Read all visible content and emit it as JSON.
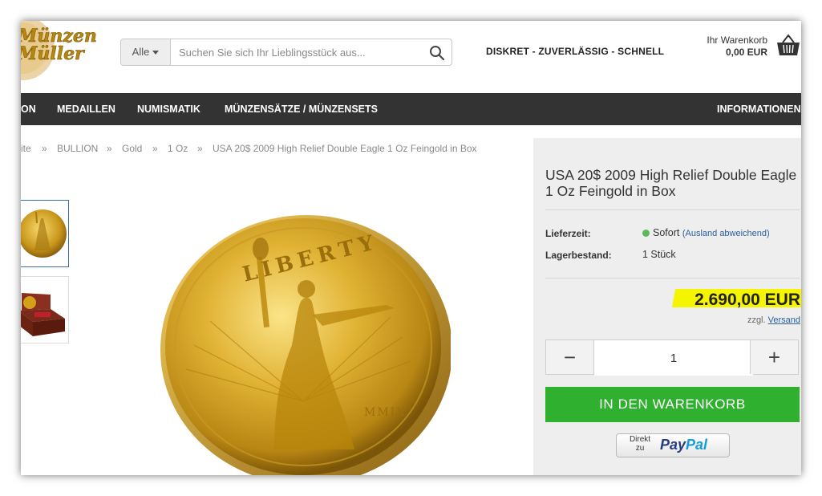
{
  "header": {
    "logo_line1": "Münzen",
    "logo_line2": "Müller",
    "search": {
      "category": "Alle",
      "placeholder": "Suchen Sie sich Ihr Lieblingsstück aus..."
    },
    "tagline": "DISKRET - ZUVERLÄSSIG - SCHNELL",
    "cart": {
      "label": "Ihr Warenkorb",
      "amount": "0,00 EUR"
    }
  },
  "nav": {
    "items": [
      "ON",
      "MEDAILLEN",
      "NUMISMATIK",
      "MÜNZENSÄTZE / MÜNZENSETS",
      "INFORMATIONEN"
    ]
  },
  "breadcrumb": {
    "items": [
      "ite",
      "BULLION",
      "Gold",
      "1 Oz",
      "USA 20$ 2009 High Relief Double Eagle 1 Oz Feingold in Box"
    ],
    "separator": "»"
  },
  "product": {
    "title": "USA 20$ 2009 High Relief Double Eagle 1 Oz Feingold in Box",
    "delivery_label": "Lieferzeit:",
    "delivery_value": "Sofort",
    "delivery_note": "(Ausland abweichend)",
    "stock_label": "Lagerbestand:",
    "stock_value": "1 Stück",
    "price": "2.690,00 EUR",
    "vat_prefix": "zzgl.",
    "vat_link": "Versand",
    "quantity": "1",
    "minus": "−",
    "plus": "+",
    "add_to_cart": "IN DEN WARENKORB",
    "paypal_direkt": "Direkt",
    "paypal_zu": "zu",
    "paypal_pay": "Pay",
    "paypal_pal": "Pal",
    "coin_legend": "LIBERTY",
    "coin_year": "MMIX"
  },
  "colors": {
    "nav_bg": "#333333",
    "accent_green": "#2fb02f",
    "price_highlight": "#f5f500",
    "panel_bg": "#eeeeee",
    "link": "#2a5d9a",
    "gold": "#d4a017"
  }
}
